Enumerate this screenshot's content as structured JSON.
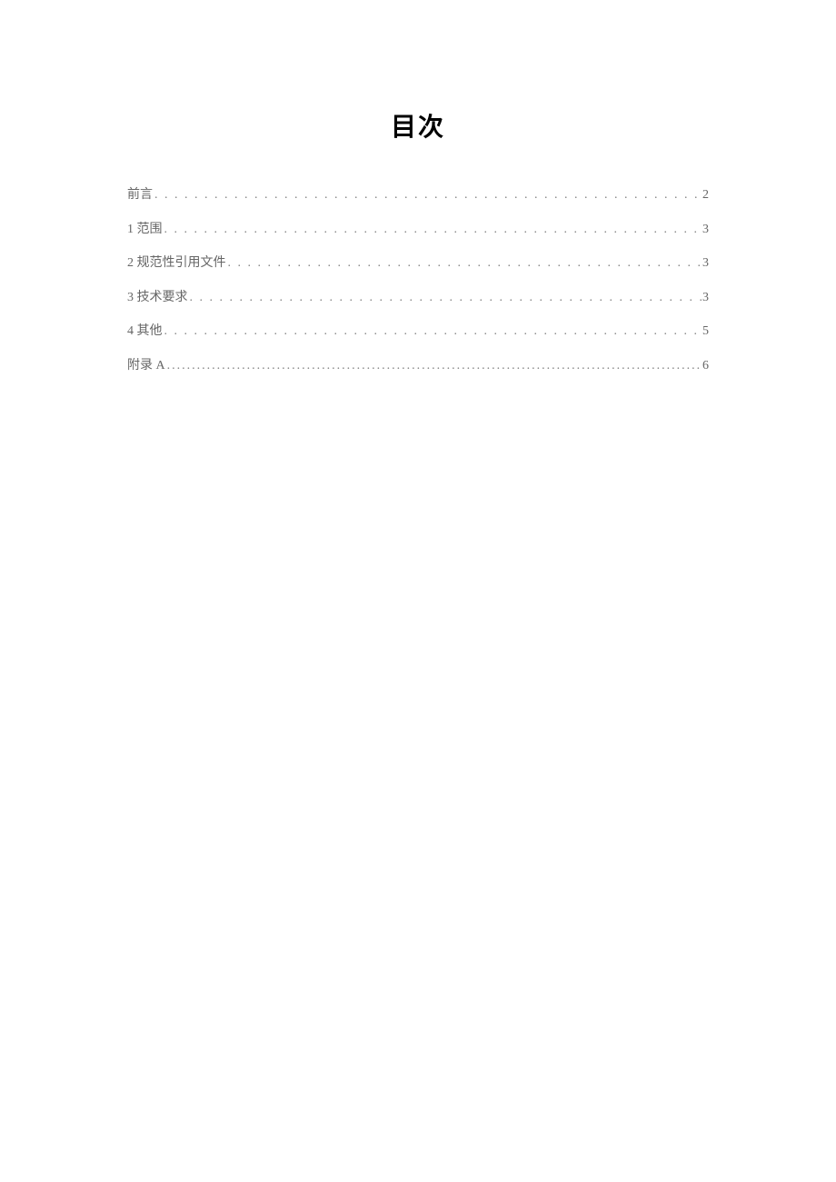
{
  "title": "目次",
  "toc": [
    {
      "label": "前言",
      "page": "2"
    },
    {
      "label": "1 范围",
      "page": "3"
    },
    {
      "label": "2 规范性引用文件",
      "page": "3"
    },
    {
      "label": "3 技术要求",
      "page": "3"
    },
    {
      "label": "4 其他",
      "page": "5"
    },
    {
      "label": "附录 A",
      "page": "6"
    }
  ]
}
